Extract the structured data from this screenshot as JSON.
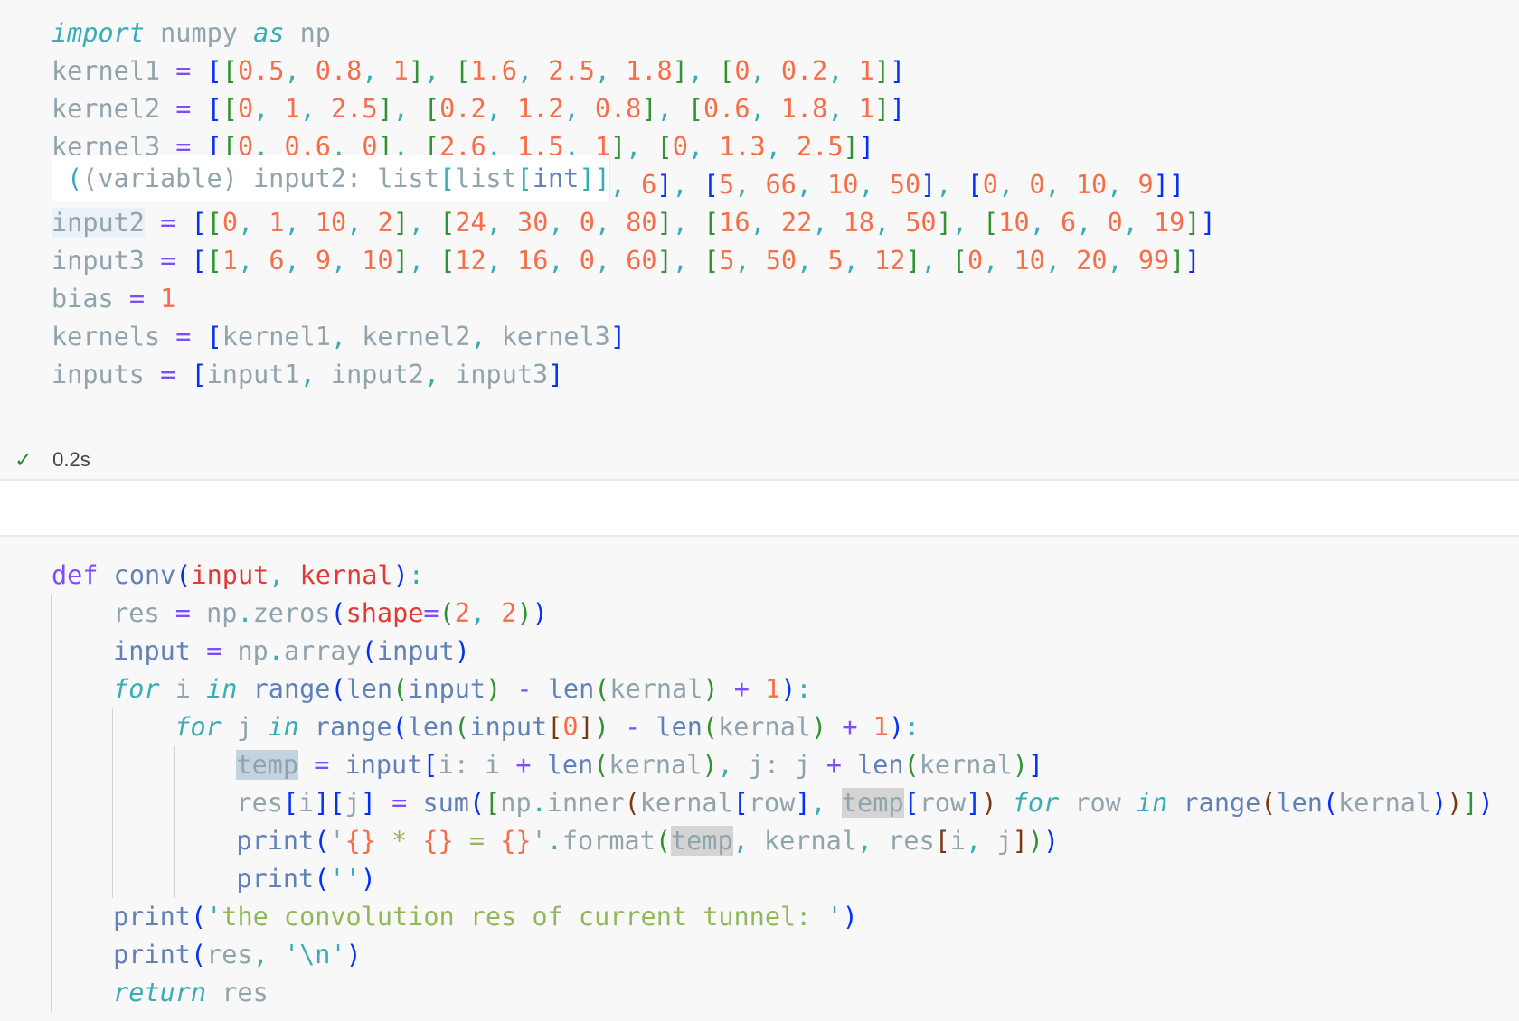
{
  "cells": [
    {
      "id": "cell1",
      "highlight_word": "input2",
      "lines": [
        "import numpy as np",
        "kernel1 = [[0.5, 0.8, 1], [1.6, 2.5, 1.8], [0, 0.2, 1]]",
        "kernel2 = [[0, 1, 2.5], [0.2, 1.2, 0.8], [0.6, 1.8, 1]]",
        "kernel3 = [[0, 0.6, 0], [2.6, 1.5, 1], [0, 1.3, 2.5]]",
        "                                    , 6], [5, 66, 10, 50], [0, 0, 10, 9]]",
        "input2 = [[0, 1, 10, 2], [24, 30, 0, 80], [16, 22, 18, 50], [10, 6, 0, 19]]",
        "input3 = [[1, 6, 9, 10], [12, 16, 0, 60], [5, 50, 5, 12], [0, 10, 20, 99]]",
        "bias = 1",
        "kernels = [kernel1, kernel2, kernel3]",
        "inputs = [input1, input2, input3]"
      ],
      "status": {
        "icon": "check-icon",
        "duration": "0.2s"
      },
      "tooltip": {
        "kind": "(variable)",
        "name": "input2:",
        "type_outer": "list",
        "type_mid": "list",
        "type_inner": "int"
      }
    },
    {
      "id": "cell2",
      "highlight_word": "temp",
      "lines": [
        "def conv(input, kernal):",
        "    res = np.zeros(shape=(2, 2))",
        "    input = np.array(input)",
        "    for i in range(len(input) - len(kernal) + 1):",
        "        for j in range(len(input[0]) - len(kernal) + 1):",
        "            temp = input[i: i + len(kernal), j: j + len(kernal)]",
        "            res[i][j] = sum([np.inner(kernal[row], temp[row]) for row in range(len(kernal))])",
        "            print('{} * {} = {}'.format(temp, kernal, res[i, j]))",
        "            print('')",
        "    print('the convolution res of current tunnel: ')",
        "    print(res, '\\n')",
        "    return res"
      ]
    }
  ],
  "colors": {
    "keyword": "#39adb5",
    "number": "#f76d47",
    "operator": "#7c4dff",
    "function": "#6182b8",
    "param": "#e53935",
    "string": "#91b859",
    "success": "#388a34"
  }
}
